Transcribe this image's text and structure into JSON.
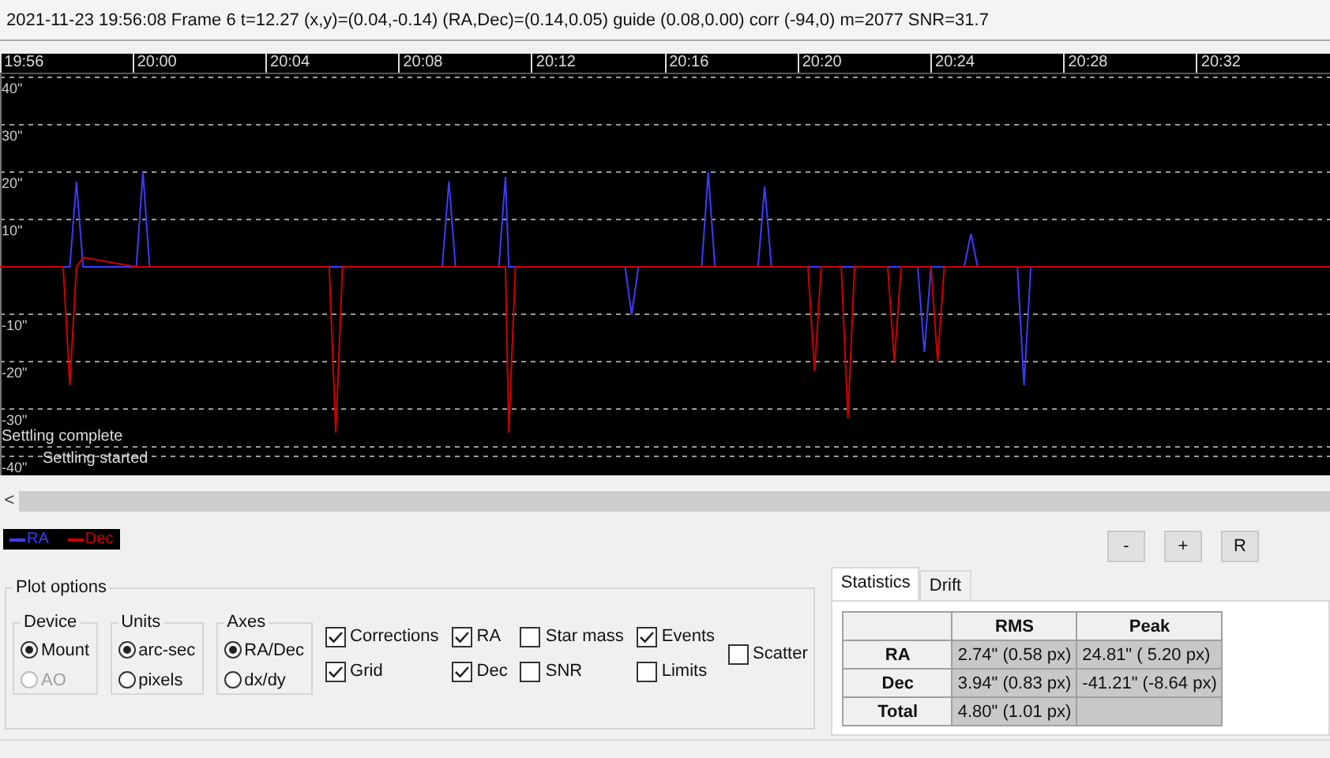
{
  "status_bar": "2021-11-23 19:56:08 Frame 6 t=12.27 (x,y)=(0.04,-0.14) (RA,Dec)=(0.14,0.05) guide (0.08,0.00) corr (-94,0) m=2077 SNR=31.7",
  "graph": {
    "chart_data": {
      "type": "line",
      "x": [
        1195.4,
        1197.3,
        1197.5,
        1197.7,
        1197.9,
        1199.5,
        1199.7,
        1199.9,
        1205.3,
        1205.5,
        1205.7,
        1208.7,
        1208.9,
        1209.1,
        1210.4,
        1210.6,
        1210.7,
        1210.9,
        1214.2,
        1214.4,
        1214.6,
        1216.5,
        1216.7,
        1216.9,
        1218.2,
        1218.4,
        1218.6,
        1219.7,
        1219.9,
        1220.1,
        1220.7,
        1220.9,
        1221.1,
        1222.1,
        1222.3,
        1222.5,
        1223.0,
        1223.2,
        1223.4,
        1223.6,
        1223.8,
        1224.4,
        1224.6,
        1224.8,
        1226.0,
        1226.2,
        1226.4,
        1235.4
      ],
      "series": [
        {
          "name": "RA",
          "color": "#3c3cff",
          "values": [
            0,
            0,
            0,
            18,
            0,
            0,
            20,
            0,
            0,
            0,
            0,
            0,
            18,
            0,
            0,
            19,
            0,
            0,
            0,
            -10,
            0,
            0,
            20,
            0,
            0,
            17,
            0,
            0,
            0,
            0,
            0,
            0,
            0,
            0,
            0,
            0,
            0,
            -18,
            0,
            0,
            0,
            0,
            7,
            0,
            0,
            -25,
            0,
            0
          ]
        },
        {
          "name": "Dec",
          "color": "#d00000",
          "values": [
            0,
            0,
            -25,
            0,
            2,
            0,
            0,
            0,
            0,
            -35,
            0,
            0,
            0,
            0,
            0,
            0,
            -35,
            0,
            0,
            0,
            0,
            0,
            0,
            0,
            0,
            0,
            0,
            0,
            -22,
            0,
            0,
            -32,
            0,
            0,
            -20,
            0,
            0,
            0,
            0,
            -20,
            0,
            0,
            0,
            0,
            0,
            0,
            0,
            0
          ]
        }
      ],
      "xlim": [
        1195.4,
        1235.4
      ],
      "ylim": [
        -44,
        40.67
      ],
      "grid": true,
      "xticks": [
        {
          "value": 1196,
          "label": "19:56"
        },
        {
          "value": 1200,
          "label": "20:00"
        },
        {
          "value": 1204,
          "label": "20:04"
        },
        {
          "value": 1208,
          "label": "20:08"
        },
        {
          "value": 1212,
          "label": "20:12"
        },
        {
          "value": 1216,
          "label": "20:16"
        },
        {
          "value": 1220,
          "label": "20:20"
        },
        {
          "value": 1224,
          "label": "20:24"
        },
        {
          "value": 1228,
          "label": "20:28"
        },
        {
          "value": 1232,
          "label": "20:32"
        }
      ],
      "yticks": [
        {
          "value": 40,
          "label": "40\""
        },
        {
          "value": 30,
          "label": "30\""
        },
        {
          "value": 20,
          "label": "20\""
        },
        {
          "value": 10,
          "label": "10\""
        },
        {
          "value": -10,
          "label": "-10\""
        },
        {
          "value": -20,
          "label": "-20\""
        },
        {
          "value": -30,
          "label": "-30\""
        },
        {
          "value": -40,
          "label": "-40\""
        }
      ]
    },
    "events": [
      "Settling complete",
      "Settling started"
    ]
  },
  "scroll_arrow": "<",
  "zoom_buttons": [
    "-",
    "+",
    "R"
  ],
  "plot_options": {
    "title": "Plot options",
    "groups": [
      {
        "title": "Device",
        "options": [
          {
            "label": "Mount",
            "selected": true,
            "disabled": false
          },
          {
            "label": "AO",
            "selected": false,
            "disabled": true
          }
        ]
      },
      {
        "title": "Units",
        "options": [
          {
            "label": "arc-sec",
            "selected": true,
            "disabled": false
          },
          {
            "label": "pixels",
            "selected": false,
            "disabled": false
          }
        ]
      },
      {
        "title": "Axes",
        "options": [
          {
            "label": "RA/Dec",
            "selected": true,
            "disabled": false
          },
          {
            "label": "dx/dy",
            "selected": false,
            "disabled": false
          }
        ]
      }
    ],
    "checkbox_columns": [
      [
        {
          "label": "Corrections",
          "checked": true
        },
        {
          "label": "Grid",
          "checked": true
        }
      ],
      [
        {
          "label": "RA",
          "checked": true
        },
        {
          "label": "Dec",
          "checked": true
        }
      ],
      [
        {
          "label": "Star mass",
          "checked": false
        },
        {
          "label": "SNR",
          "checked": false
        }
      ],
      [
        {
          "label": "Events",
          "checked": true
        },
        {
          "label": "Limits",
          "checked": false
        }
      ],
      [
        {
          "label": "Scatter",
          "checked": false
        }
      ]
    ]
  },
  "stats_tabs": [
    {
      "label": "Statistics",
      "selected": true
    },
    {
      "label": "Drift",
      "selected": false
    }
  ],
  "stats_table": {
    "columns": [
      "RMS",
      "Peak"
    ],
    "rows": [
      {
        "label": "RA",
        "cells": [
          "2.74\" (0.58 px)",
          "24.81\" ( 5.20 px)"
        ]
      },
      {
        "label": "Dec",
        "cells": [
          "3.94\" (0.83 px)",
          "-41.21\" (-8.64 px)"
        ]
      },
      {
        "label": "Total",
        "cells": [
          "4.80\" (1.01 px)"
        ]
      }
    ]
  }
}
